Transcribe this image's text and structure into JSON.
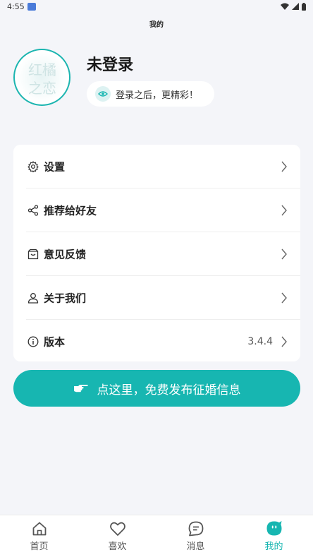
{
  "status_bar": {
    "time": "4:55"
  },
  "header": {
    "title": "我的"
  },
  "profile": {
    "name": "未登录",
    "hint": "登录之后，更精彩！",
    "avatar_text": "红橘之恋"
  },
  "menu": {
    "items": [
      {
        "label": "设置",
        "icon": "gear-icon"
      },
      {
        "label": "推荐给好友",
        "icon": "share-icon"
      },
      {
        "label": "意见反馈",
        "icon": "feedback-icon"
      },
      {
        "label": "关于我们",
        "icon": "user-icon"
      },
      {
        "label": "版本",
        "icon": "info-icon",
        "value": "3.4.4"
      }
    ]
  },
  "publish_button": {
    "label": "点这里，免费发布征婚信息"
  },
  "tabs": [
    {
      "label": "首页",
      "icon": "home-icon"
    },
    {
      "label": "喜欢",
      "icon": "heart-icon"
    },
    {
      "label": "消息",
      "icon": "message-icon"
    },
    {
      "label": "我的",
      "icon": "profile-icon",
      "active": true
    }
  ],
  "colors": {
    "accent": "#17b6b1",
    "background": "#f4f5f9"
  }
}
